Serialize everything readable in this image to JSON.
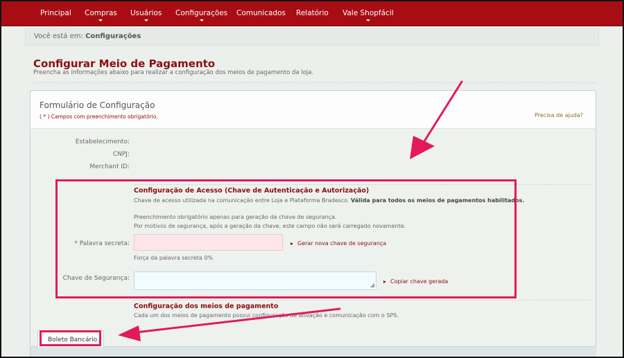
{
  "nav": {
    "items": [
      {
        "label": "Principal",
        "has_dropdown": false
      },
      {
        "label": "Compras",
        "has_dropdown": true
      },
      {
        "label": "Usuários",
        "has_dropdown": true
      },
      {
        "label": "Configurações",
        "has_dropdown": true
      },
      {
        "label": "Comunicados",
        "has_dropdown": false
      },
      {
        "label": "Relatório",
        "has_dropdown": false
      },
      {
        "label": "Vale Shopfácil",
        "has_dropdown": true
      }
    ]
  },
  "breadcrumb": {
    "prefix": "Você está em:",
    "current": "Configurações"
  },
  "page": {
    "title": "Configurar Meio de Pagamento",
    "subtitle": "Preencha as informações abaixo para realizar a configuração dos meios de pagamento da loja."
  },
  "form": {
    "title": "Formulário de Configuração",
    "required_note": "( * ) Campos com preenchimento obrigatório.",
    "help_link": "Precisa de ajuda?",
    "info_labels": {
      "establishment": "Estabelecimento:",
      "cnpj": "CNPJ:",
      "merchant_id": "Merchant ID:"
    },
    "access": {
      "title": "Configuração de Acesso (Chave de Autenticação e Autorização)",
      "desc_plain": "Chave de acesso utilizada na comunicação entre Loja e Plataforma Bradesco.",
      "desc_bold": "Válida para todos os meios de pagamentos habilitados.",
      "note_line1": "Preenchimento obrigatório apenas para geração da chave de segurança.",
      "note_line2": "Por motivos de segurança, após a geração da chave, este campo não será carregado novamente.",
      "password_label": "* Palavra secreta:",
      "password_value": "",
      "generate_link": "Gerar nova chave de segurança",
      "strength_text": "Força da palavra secreta 0%",
      "key_label": "Chave de Segurança:",
      "key_value": "",
      "copy_link": "Copiar chave gerada"
    },
    "payments": {
      "title": "Configuração dos meios de pagamento",
      "desc": "Cada um dos meios de pagamento possui configuração de ativação e comunicação com o SPS."
    },
    "tabs": [
      {
        "label": "Boleto Bancário",
        "active": true
      }
    ]
  },
  "annotation": {
    "color": "#e21a5a"
  }
}
